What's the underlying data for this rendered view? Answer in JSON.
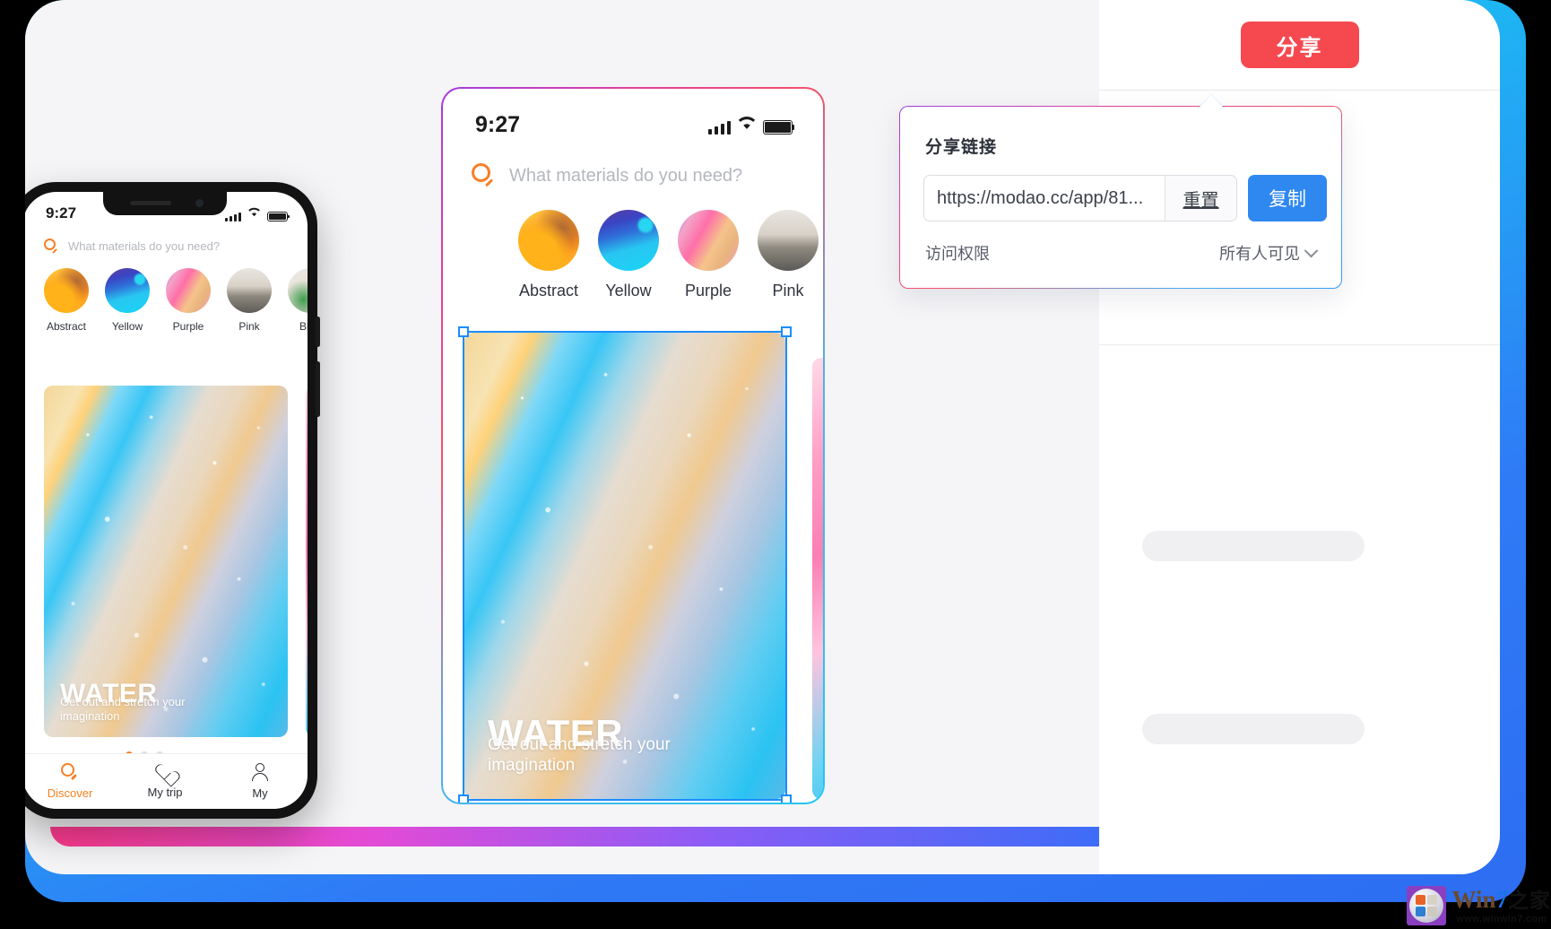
{
  "app": {
    "share_button_label": "分享"
  },
  "popover": {
    "title": "分享链接",
    "link_value": "https://modao.cc/app/81...",
    "link_placeholder": "https://modao.cc/app/81...",
    "reset_label": "重置",
    "copy_label": "复制",
    "permission_label": "访问权限",
    "permission_value": "所有人可见"
  },
  "phone": {
    "status": {
      "time": "9:27"
    },
    "search": {
      "placeholder": "What materials do you need?"
    },
    "categories": [
      {
        "label": "Abstract",
        "swatch": "abstract"
      },
      {
        "label": "Yellow",
        "swatch": "yellow"
      },
      {
        "label": "Purple",
        "swatch": "purple"
      },
      {
        "label": "Pink",
        "swatch": "pink"
      },
      {
        "label": "Blue",
        "swatch": "blue"
      }
    ],
    "card": {
      "title": "WATER",
      "subtitle": "Get out and stretch your imagination"
    },
    "carousel": {
      "count": 3,
      "active_index": 0
    },
    "tabs": [
      {
        "label": "Discover",
        "icon": "search-icon",
        "active": true
      },
      {
        "label": "My trip",
        "icon": "heart-icon",
        "active": false
      },
      {
        "label": "My",
        "icon": "person-icon",
        "active": false
      }
    ]
  },
  "watermark": {
    "brand_win": "Win",
    "brand_seven": "7",
    "brand_cn": "之家",
    "url": "www.winwin7.com"
  },
  "colors": {
    "share_red": "#f5484f",
    "copy_blue": "#2f88f0",
    "accent_orange": "#f7801f",
    "selection_blue": "#1a8cff"
  }
}
